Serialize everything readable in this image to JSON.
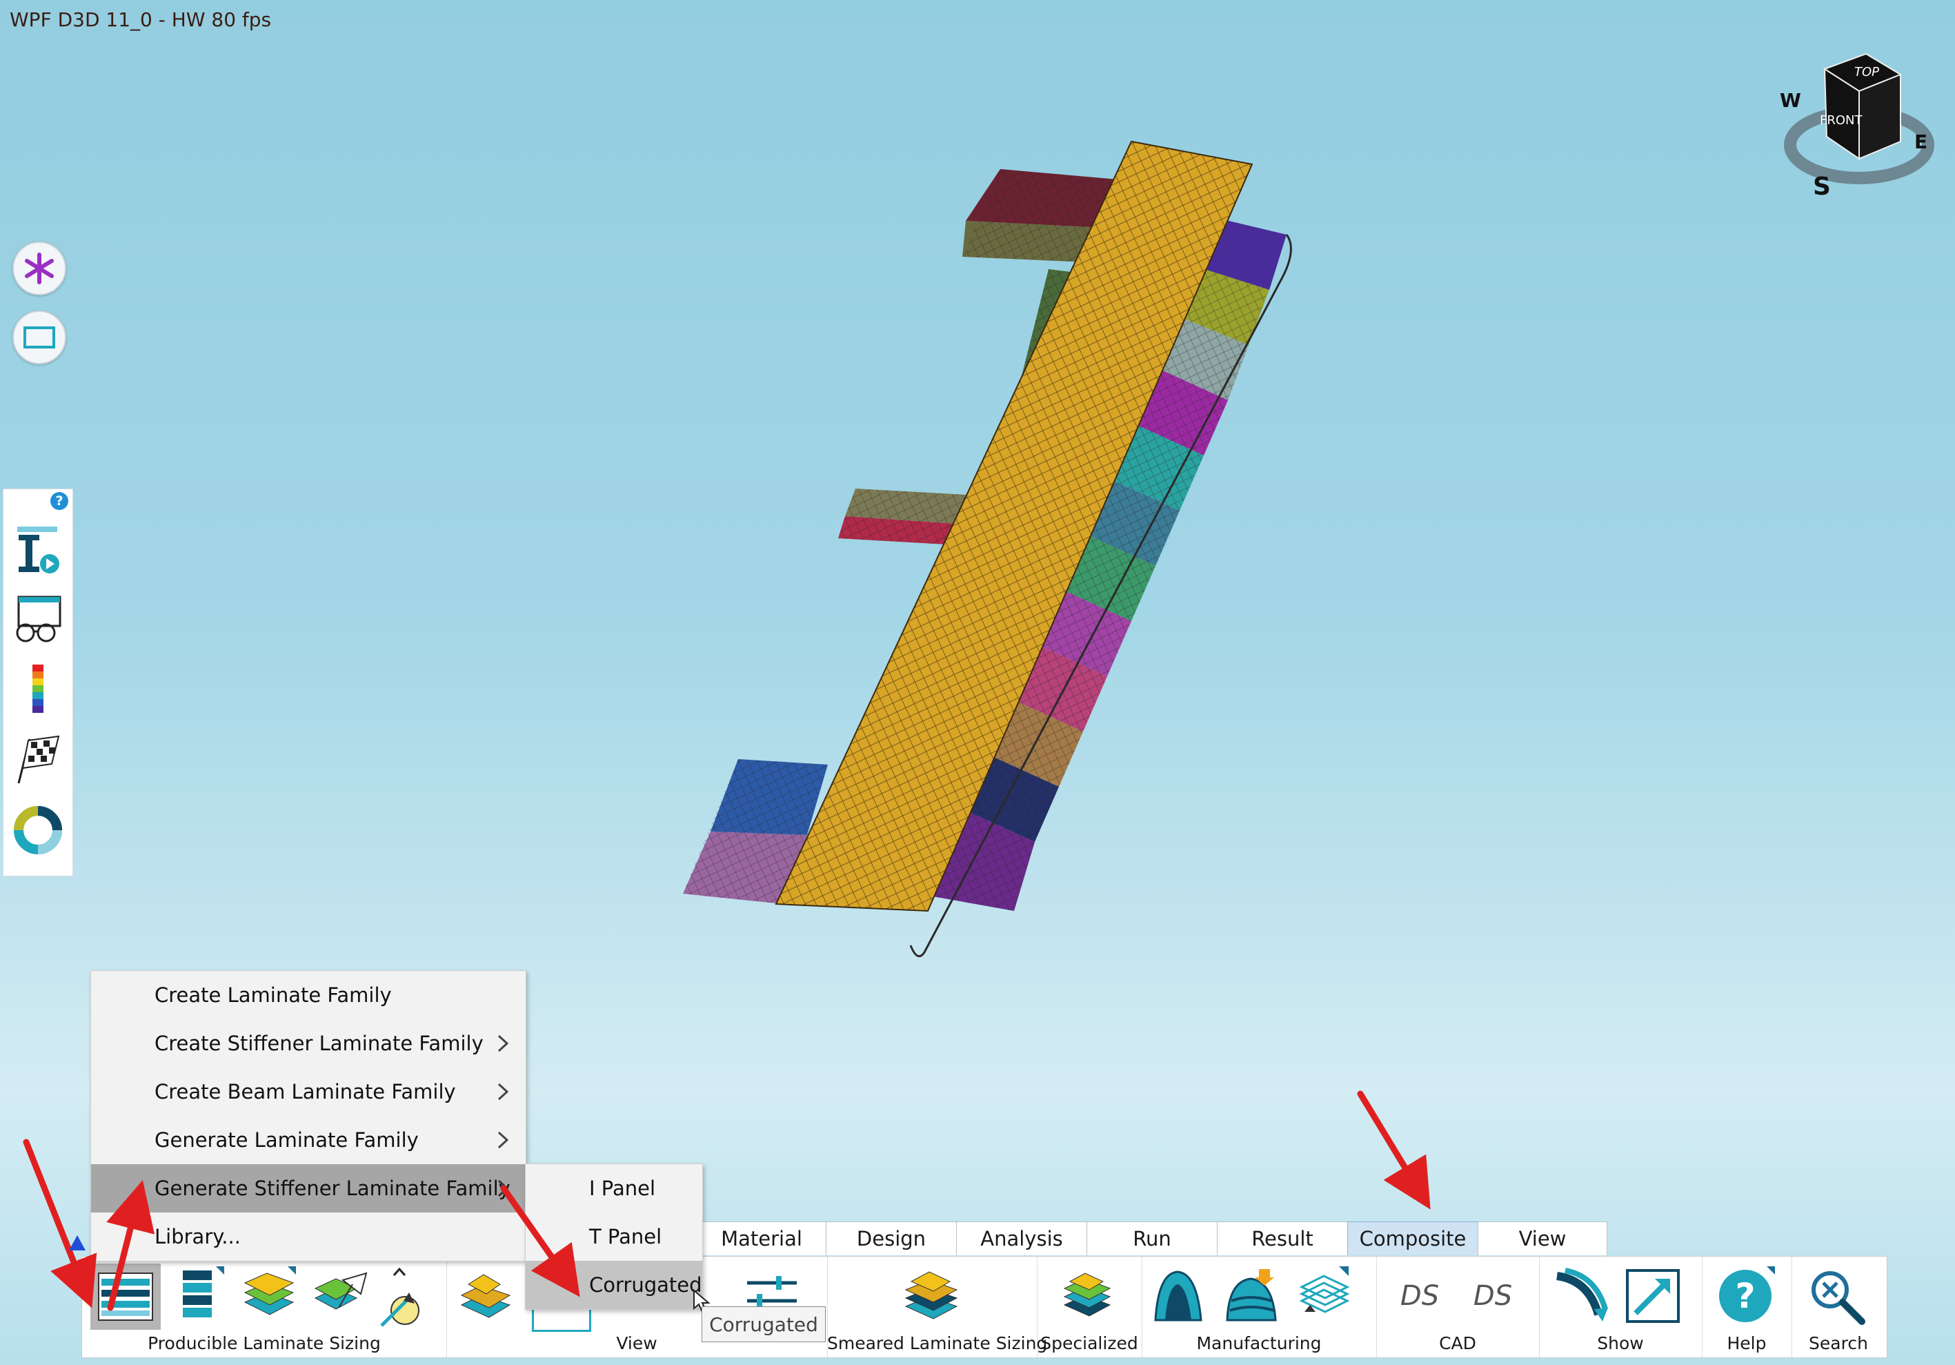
{
  "viewport": {
    "fps_label": "WPF D3D 11_0 - HW  80 fps",
    "view_cube": {
      "top": "TOP",
      "front": "FRONT",
      "west": "W",
      "east": "E",
      "south": "S"
    }
  },
  "left_toolbar": {
    "help": "?",
    "items": [
      "part-info-icon",
      "inspect-glasses-icon",
      "color-scale-icon",
      "checkered-flag-icon",
      "color-ring-icon"
    ]
  },
  "context_menu": {
    "items": [
      {
        "label": "Create Laminate Family",
        "has_submenu": false
      },
      {
        "label": "Create Stiffener Laminate Family",
        "has_submenu": true
      },
      {
        "label": "Create Beam Laminate Family",
        "has_submenu": true
      },
      {
        "label": "Generate Laminate Family",
        "has_submenu": true
      },
      {
        "label": "Generate Stiffener Laminate Family",
        "has_submenu": true,
        "highlighted": true
      },
      {
        "label": "Library...",
        "has_submenu": false
      }
    ]
  },
  "submenu": {
    "items": [
      {
        "label": "I Panel"
      },
      {
        "label": "T Panel"
      },
      {
        "label": "Corrugated",
        "highlighted": true
      }
    ]
  },
  "tooltip": {
    "text": "Corrugated"
  },
  "ribbon": {
    "tabs": [
      {
        "label": "Material"
      },
      {
        "label": "Design"
      },
      {
        "label": "Analysis"
      },
      {
        "label": "Run"
      },
      {
        "label": "Result"
      },
      {
        "label": "Composite",
        "active": true
      },
      {
        "label": "View"
      }
    ],
    "groups": {
      "producible": "Producible Laminate Sizing",
      "view": "View",
      "smeared": "Smeared Laminate Sizing",
      "specialized": "Specialized",
      "manufacturing": "Manufacturing",
      "cad": "CAD",
      "show": "Show",
      "help": "Help",
      "search": "Search"
    },
    "cad_logo": "DS"
  },
  "colors": {
    "accent_teal": "#1fa7bd",
    "highlight": "#a6a6a6",
    "active_tab": "#cfe3f3",
    "arrow_red": "#e02020",
    "mesh_gold": "#d9a527"
  }
}
